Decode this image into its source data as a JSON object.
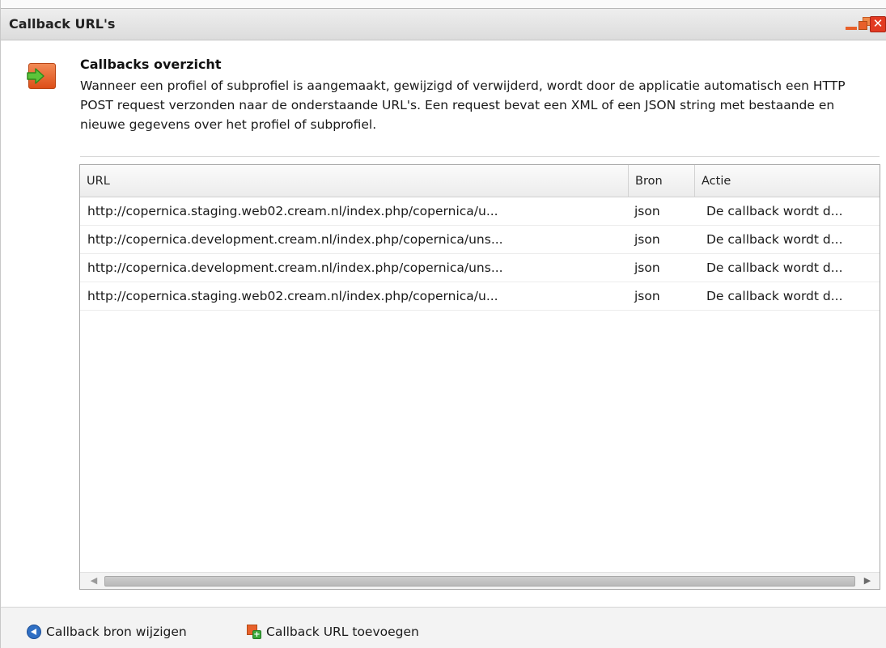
{
  "window": {
    "title": "Callback URL's",
    "controls": {
      "minimize": "minimize-icon",
      "restore": "restore-icon",
      "close": "close-icon"
    }
  },
  "header": {
    "icon": "callback-arrow-icon",
    "title": "Callbacks overzicht",
    "description": "Wanneer een profiel of subprofiel is aangemaakt, gewijzigd of verwijderd, wordt door de applicatie automatisch een HTTP POST request verzonden naar de onderstaande URL's. Een request bevat een XML of een JSON string met bestaande en nieuwe gegevens over het profiel of subprofiel."
  },
  "table": {
    "columns": [
      "URL",
      "Bron",
      "Actie"
    ],
    "rows": [
      {
        "url": "http://copernica.staging.web02.cream.nl/index.php/copernica/u...",
        "bron": "json",
        "actie": "De callback wordt d..."
      },
      {
        "url": "http://copernica.development.cream.nl/index.php/copernica/uns...",
        "bron": "json",
        "actie": "De callback wordt d..."
      },
      {
        "url": "http://copernica.development.cream.nl/index.php/copernica/uns...",
        "bron": "json",
        "actie": "De callback wordt d..."
      },
      {
        "url": "http://copernica.staging.web02.cream.nl/index.php/copernica/u...",
        "bron": "json",
        "actie": "De callback wordt d..."
      }
    ]
  },
  "footer": {
    "edit_source": {
      "label": "Callback bron wijzigen",
      "icon": "back-arrow-icon"
    },
    "add_url": {
      "label": "Callback URL toevoegen",
      "icon": "add-page-icon"
    }
  },
  "colors": {
    "accent": "#e8602a",
    "close": "#e23a22",
    "link_icon": "#2f6fc4",
    "add_icon": "#3aa83a"
  }
}
